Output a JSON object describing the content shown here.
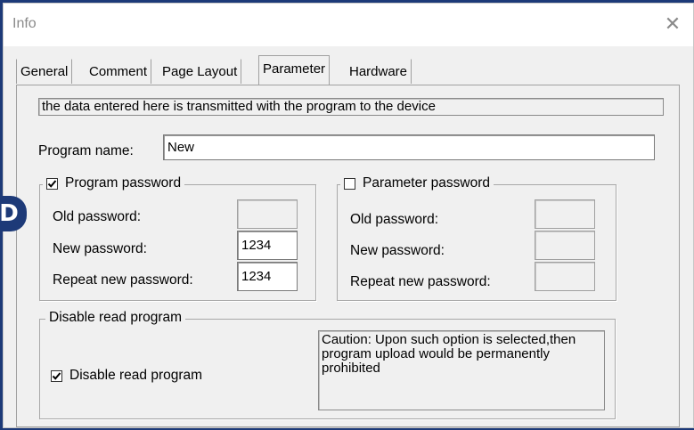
{
  "window": {
    "title": "Info",
    "close_glyph": "✕"
  },
  "badge": {
    "letter": "D",
    "color": "#1d3a78"
  },
  "tabs": [
    {
      "label": "General",
      "active": false
    },
    {
      "label": "Comment",
      "active": false
    },
    {
      "label": "Page Layout",
      "active": false
    },
    {
      "label": "Parameter",
      "active": true
    },
    {
      "label": "Hardware",
      "active": false
    }
  ],
  "info_text": "the data entered here is transmitted  with the  program  to the device",
  "program_name": {
    "label": "Program name:",
    "value": "New"
  },
  "program_password": {
    "legend": "Program password",
    "checked": true,
    "old_label": "Old password:",
    "old_value": "",
    "new_label": "New password:",
    "new_value": "1234",
    "repeat_label": "Repeat new password:",
    "repeat_value": "1234"
  },
  "parameter_password": {
    "legend": "Parameter password",
    "checked": false,
    "old_label": "Old password:",
    "old_value": "",
    "new_label": "New password:",
    "new_value": "",
    "repeat_label": "Repeat new password:",
    "repeat_value": ""
  },
  "disable_read": {
    "legend": "Disable read program",
    "checkbox_label": "Disable read program",
    "checked": true,
    "caution": "Caution: Upon such option is selected,then program upload would be permanently prohibited"
  },
  "icons": {
    "check": "check-icon",
    "close": "close-icon"
  }
}
